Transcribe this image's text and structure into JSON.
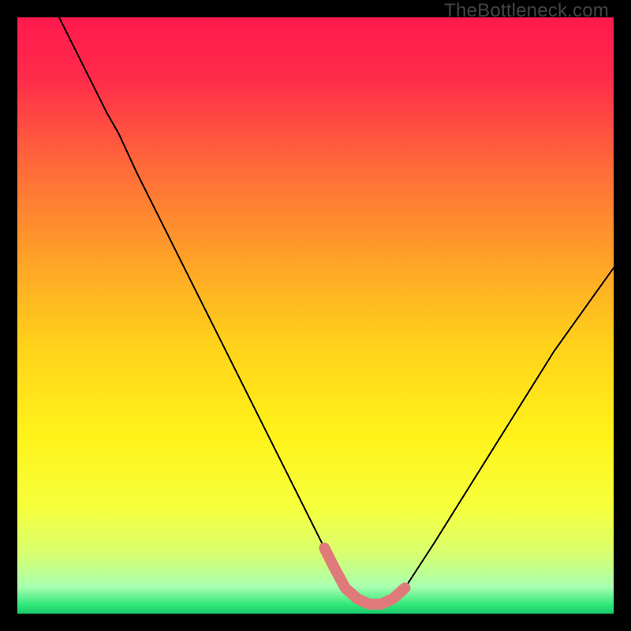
{
  "watermark": "TheBottleneck.com",
  "chart_data": {
    "type": "line",
    "title": "",
    "xlabel": "",
    "ylabel": "",
    "xlim": [
      0,
      100
    ],
    "ylim": [
      0,
      100
    ],
    "series": [
      {
        "name": "curve",
        "x": [
          7,
          10,
          15,
          17,
          20,
          25,
          30,
          35,
          40,
          45,
          50,
          51.5,
          53,
          55,
          57,
          59,
          61,
          63,
          65,
          70,
          75,
          80,
          85,
          90,
          95,
          100
        ],
        "y": [
          100,
          94,
          84,
          80.5,
          74,
          64,
          54,
          44,
          34,
          24,
          14,
          11,
          8,
          4.3,
          2.5,
          1.6,
          1.6,
          2.5,
          4.3,
          12,
          20,
          28,
          36,
          44,
          51,
          58
        ]
      },
      {
        "name": "highlight",
        "x": [
          51.5,
          53,
          55,
          57,
          59,
          61,
          63,
          65
        ],
        "y": [
          11,
          8,
          4.3,
          2.5,
          1.6,
          1.6,
          2.5,
          4.3
        ]
      }
    ],
    "gradient_stops": [
      {
        "offset": 0.0,
        "color": "#ff1a4d"
      },
      {
        "offset": 0.1,
        "color": "#ff2a4a"
      },
      {
        "offset": 0.25,
        "color": "#ff6a3a"
      },
      {
        "offset": 0.4,
        "color": "#ffa028"
      },
      {
        "offset": 0.55,
        "color": "#ffd21a"
      },
      {
        "offset": 0.7,
        "color": "#fff21a"
      },
      {
        "offset": 0.82,
        "color": "#f6ff3a"
      },
      {
        "offset": 0.9,
        "color": "#d8ff70"
      },
      {
        "offset": 0.955,
        "color": "#a8ffb0"
      },
      {
        "offset": 0.985,
        "color": "#30e87a"
      },
      {
        "offset": 1.0,
        "color": "#18c96a"
      }
    ],
    "highlight_color": "#e07a7a",
    "curve_color": "#000000"
  }
}
